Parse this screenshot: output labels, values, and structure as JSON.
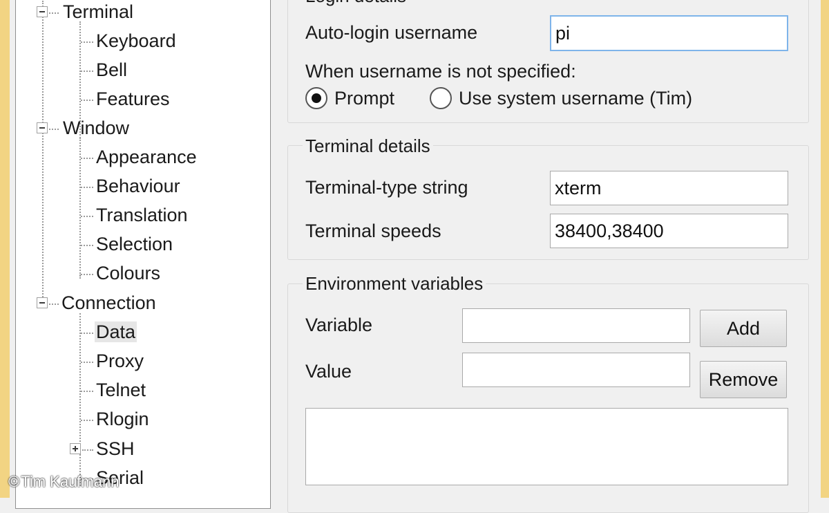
{
  "tree": {
    "items": [
      {
        "label": "Terminal"
      },
      {
        "label": "Keyboard"
      },
      {
        "label": "Bell"
      },
      {
        "label": "Features"
      },
      {
        "label": "Window"
      },
      {
        "label": "Appearance"
      },
      {
        "label": "Behaviour"
      },
      {
        "label": "Translation"
      },
      {
        "label": "Selection"
      },
      {
        "label": "Colours"
      },
      {
        "label": "Connection"
      },
      {
        "label": "Data"
      },
      {
        "label": "Proxy"
      },
      {
        "label": "Telnet"
      },
      {
        "label": "Rlogin"
      },
      {
        "label": "SSH"
      },
      {
        "label": "Serial"
      }
    ],
    "selected": "Data"
  },
  "login": {
    "group_title": "Login details",
    "autologin_label": "Auto-login username",
    "autologin_value": "pi",
    "not_specified_label": "When username is not specified:",
    "radio_prompt": "Prompt",
    "radio_system": "Use system username (Tim)",
    "selected_option": "Prompt"
  },
  "terminal": {
    "group_title": "Terminal details",
    "type_label": "Terminal-type string",
    "type_value": "xterm",
    "speeds_label": "Terminal speeds",
    "speeds_value": "38400,38400"
  },
  "environment": {
    "group_title": "Environment variables",
    "variable_label": "Variable",
    "variable_value": "",
    "value_label": "Value",
    "value_value": "",
    "add_button": "Add",
    "remove_button": "Remove",
    "list_items": []
  },
  "watermark": {
    "symbol": "©",
    "text": "Tim Kaufmann"
  },
  "colors": {
    "frame": "#f2d483",
    "focus_border": "#7eb4ea",
    "panel_bg": "#f0f0f0"
  }
}
